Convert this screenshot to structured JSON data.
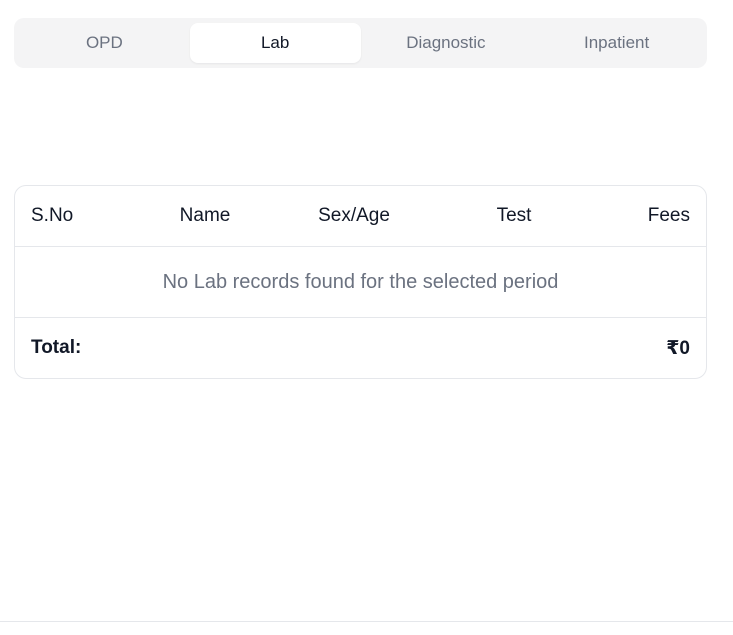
{
  "tabs": [
    {
      "label": "OPD",
      "active": false
    },
    {
      "label": "Lab",
      "active": true
    },
    {
      "label": "Diagnostic",
      "active": false
    },
    {
      "label": "Inpatient",
      "active": false
    }
  ],
  "table": {
    "columns": [
      "S.No",
      "Name",
      "Sex/Age",
      "Test",
      "Fees"
    ],
    "rows": [],
    "empty_message": "No Lab records found for the selected period",
    "total_label": "Total:",
    "total_value": "₹0"
  }
}
